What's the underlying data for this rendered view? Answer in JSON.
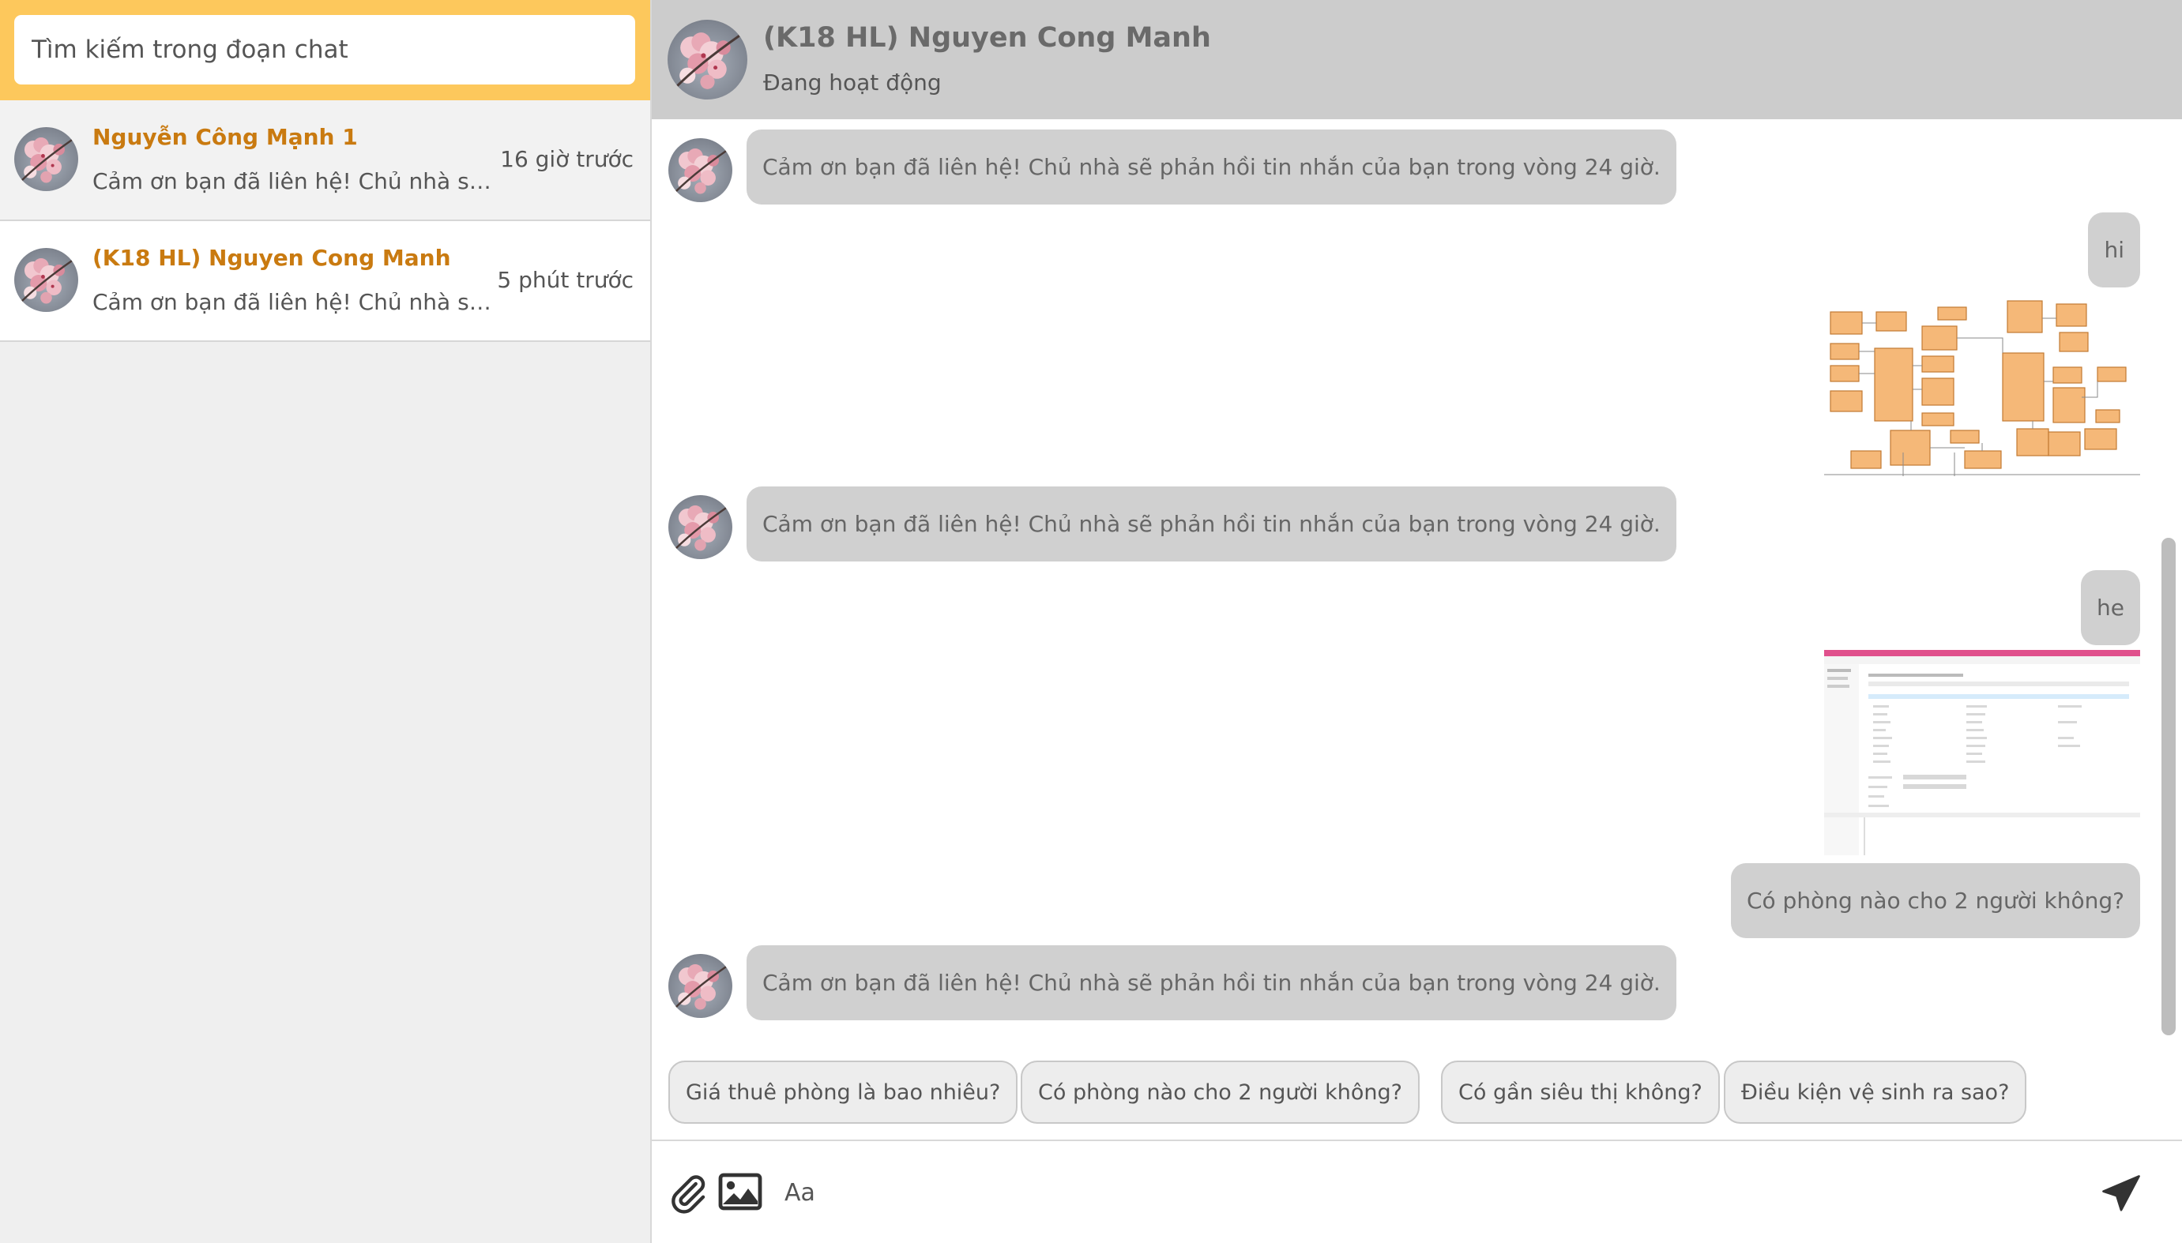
{
  "sidebar": {
    "search_placeholder": "Tìm kiếm trong đoạn chat",
    "conversations": [
      {
        "name": "Nguyễn Công Mạnh 1",
        "time": "16 giờ trước",
        "preview": "Cảm ơn bạn đã liên hệ! Chủ nhà sẽ phản hồi tin nhắn của bạn trong vòng 24 giờ.",
        "active": true
      },
      {
        "name": "(K18 HL) Nguyen Cong Manh",
        "time": "5 phút trước",
        "preview": "Cảm ơn bạn đã liên hệ! Chủ nhà sẽ phản hồi tin nhắn của bạn trong vòng 24 giờ.",
        "active": false
      }
    ]
  },
  "chat": {
    "title": "(K18 HL) Nguyen Cong Manh",
    "status": "Đang hoạt động"
  },
  "messages": [
    {
      "from": "them",
      "text": "Cảm ơn bạn đã liên hệ! Chủ nhà sẽ phản hồi tin nhắn của bạn trong vòng 24 giờ."
    },
    {
      "from": "me",
      "text": "hi"
    },
    {
      "from": "me",
      "image": "er-diagram-screenshot"
    },
    {
      "from": "them",
      "text": "Cảm ơn bạn đã liên hệ! Chủ nhà sẽ phản hồi tin nhắn của bạn trong vòng 24 giờ."
    },
    {
      "from": "me",
      "text": "he"
    },
    {
      "from": "me",
      "image": "form-editor-screenshot"
    },
    {
      "from": "me",
      "text": "Có phòng nào cho 2 người không?"
    },
    {
      "from": "them",
      "text": "Cảm ơn bạn đã liên hệ! Chủ nhà sẽ phản hồi tin nhắn của bạn trong vòng 24 giờ."
    }
  ],
  "quick_replies": [
    "Giá thuê phòng là bao nhiêu?",
    "Có phòng nào cho 2 người không?",
    "Có gần siêu thị không?",
    "Điều kiện vệ sinh ra sao?"
  ],
  "composer": {
    "placeholder": "Aa",
    "icons": [
      "paperclip-icon",
      "image-icon",
      "send-icon"
    ]
  },
  "colors": {
    "accent": "#fdc85c",
    "name_color": "#c97a10",
    "header_bg": "#cccccc",
    "bubble_bg": "#d0d0d0",
    "sidebar_bg": "#efefef"
  }
}
